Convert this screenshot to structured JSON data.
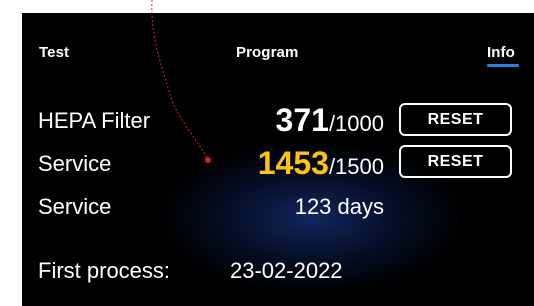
{
  "tabs": [
    {
      "label": "Test",
      "active": false
    },
    {
      "label": "Program",
      "active": false
    },
    {
      "label": "Info",
      "active": true
    }
  ],
  "colors": {
    "background": "#000000",
    "accent": "#2f7fe0",
    "highlight": "#ffc21a",
    "annotation": "#e02020"
  },
  "rows": [
    {
      "label": "HEPA Filter",
      "current": "371",
      "max": "/1000",
      "button": "RESET"
    },
    {
      "label": "Service",
      "current": "1453",
      "max": "/1500",
      "button": "RESET"
    },
    {
      "label": "Service",
      "value": "123 days"
    },
    {
      "label": "First process:",
      "value": "23-02-2022"
    }
  ]
}
